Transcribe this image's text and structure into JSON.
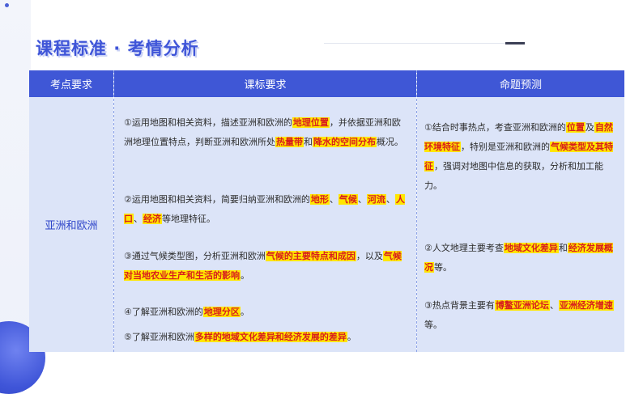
{
  "slide": {
    "title": "课程标准 · 考情分析",
    "accent_color": "#3f55d8"
  },
  "table": {
    "headers": [
      "考点要求",
      "课标要求",
      "命题预测"
    ],
    "region": "亚洲和欧洲",
    "standards": [
      {
        "t1": "①运用地图和相关资料，描述亚洲和欧洲的",
        "h1": "地理位置",
        "t2": "，并依据亚洲和欧洲地理位置特点，判断亚洲和欧洲所处",
        "h2": "热量带",
        "t3": "和",
        "h3": "降水的空间分布",
        "t4": "概况。"
      },
      {
        "t1": "②运用地图和相关资料，简要归纳亚洲和欧洲的",
        "h1": "地形",
        "t2": "、",
        "h2": "气候",
        "t3": "、",
        "h3": "河流",
        "t4": "、",
        "h4": "人口",
        "t5": "、",
        "h5": "经济",
        "t6": "等地理特征。"
      },
      {
        "t1": "③通过气候类型图，分析亚洲和欧洲",
        "h1": "气候的主要特点和成因",
        "t2": "，以及",
        "h2": "气候对当地农业生产和生活的影响",
        "t3": "。"
      },
      {
        "t1": "④了解亚洲和欧洲的",
        "h1": "地理分区",
        "t2": "。"
      },
      {
        "t1": "⑤了解亚洲和欧洲",
        "h1": "多样的地域文化差异和经济发展的差异",
        "t2": "。"
      }
    ],
    "predictions": [
      {
        "t1": "①结合时事热点，考查亚洲和欧洲的",
        "h1": "位置",
        "t2": "及",
        "h2": "自然环境特征",
        "t3": "，特别是亚洲和欧洲的",
        "h3": "气候类型及其特征",
        "t4": "，强调对地图中信息的获取，分析和加工能力。"
      },
      {
        "t1": "②人文地理主要考查",
        "h1": "地域文化差异",
        "t2": "和",
        "h2": "经济发展概况",
        "t3": "等。"
      },
      {
        "t1": "③热点背景主要有",
        "h1": "博鳌亚洲论坛",
        "t2": "、",
        "h2": "亚洲经济增速",
        "t3": "等。"
      }
    ],
    "highlight_bg": "#ffe600",
    "highlight_fg": "#d81e1e",
    "header_bg": "#3f57d6",
    "cell_bg": "#dce4f8"
  }
}
